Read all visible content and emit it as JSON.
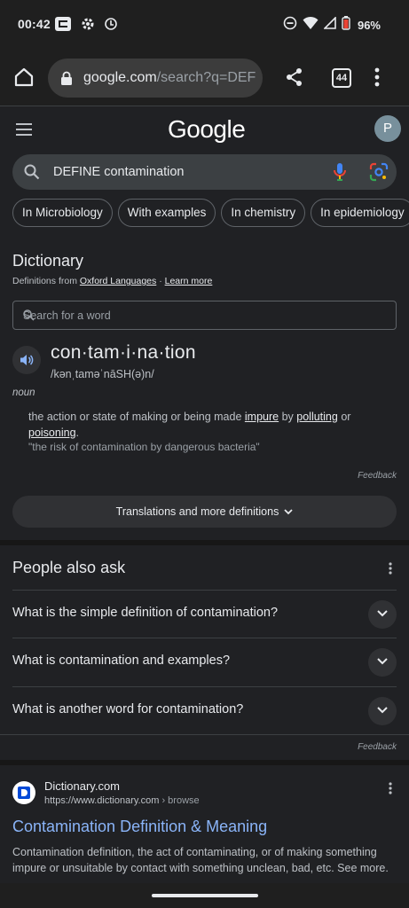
{
  "status_bar": {
    "time": "00:42",
    "battery": "96%"
  },
  "browser": {
    "url_main": "google.com",
    "url_path": "/search?q=DEFINI",
    "tab_count": "44"
  },
  "google": {
    "logo": "Google",
    "avatar_initial": "P",
    "query": "DEFINE contamination",
    "chips": [
      "In Microbiology",
      "With examples",
      "In chemistry",
      "In epidemiology"
    ]
  },
  "dictionary": {
    "title": "Dictionary",
    "source_prefix": "Definitions from",
    "source_name": "Oxford Languages",
    "separator": " · ",
    "learn_more": "Learn more",
    "search_placeholder": "Search for a word",
    "word": "con·tam·i·na·tion",
    "pronunciation": "/kənˌtaməˈnāSH(ə)n/",
    "part_of_speech": "noun",
    "definition": {
      "prefix": "the action or state of making or being made ",
      "link1": "impure",
      "mid1": " by ",
      "link2": "polluting",
      "mid2": " or ",
      "link3": "poisoning",
      "suffix": "."
    },
    "example": "\"the risk of contamination by dangerous bacteria\"",
    "feedback": "Feedback",
    "translations_button": "Translations and more definitions"
  },
  "people_also_ask": {
    "title": "People also ask",
    "questions": [
      "What is the simple definition of contamination?",
      "What is contamination and examples?",
      "What is another word for contamination?"
    ],
    "feedback": "Feedback"
  },
  "result": {
    "site_name": "Dictionary.com",
    "url": "https://www.dictionary.com",
    "breadcrumb": " › browse",
    "title": "Contamination Definition & Meaning",
    "snippet": "Contamination definition, the act of contaminating, or of making something impure or unsuitable by contact with something unclean, bad, etc. See more."
  },
  "colors": {
    "background": "#202124",
    "link": "#8ab4f8",
    "chip_border": "#5f6368"
  }
}
